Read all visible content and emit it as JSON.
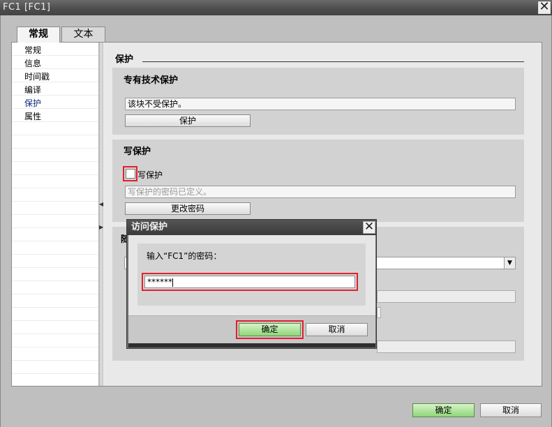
{
  "window": {
    "title": "FC1 [FC1]",
    "close_icon": "✕"
  },
  "tabs": [
    {
      "label": "常规",
      "active": true
    },
    {
      "label": "文本",
      "active": false
    }
  ],
  "nav": {
    "items": [
      {
        "label": "常规"
      },
      {
        "label": "信息"
      },
      {
        "label": "时间戳"
      },
      {
        "label": "编译"
      },
      {
        "label": "保护",
        "selected": true
      },
      {
        "label": "属性"
      }
    ]
  },
  "main": {
    "section_title": "保护",
    "know_how": {
      "title": "专有技术保护",
      "status_text": "该块不受保护。",
      "button_label": "保护"
    },
    "write_protect": {
      "title": "写保护",
      "checkbox_label": "写保护",
      "status_text": "写保护的密码已定义。",
      "button_label": "更改密码"
    },
    "third_group": {
      "title_visible_fragment": "随"
    }
  },
  "footer": {
    "ok_label": "确定",
    "cancel_label": "取消"
  },
  "dialog": {
    "title": "访问保护",
    "close_icon": "✕",
    "prompt": "输入“FC1”的密码：",
    "password_value": "******",
    "ok_label": "确定",
    "cancel_label": "取消"
  },
  "colors": {
    "highlight_red": "#e2202a",
    "ok_green": "#8ed77a"
  }
}
